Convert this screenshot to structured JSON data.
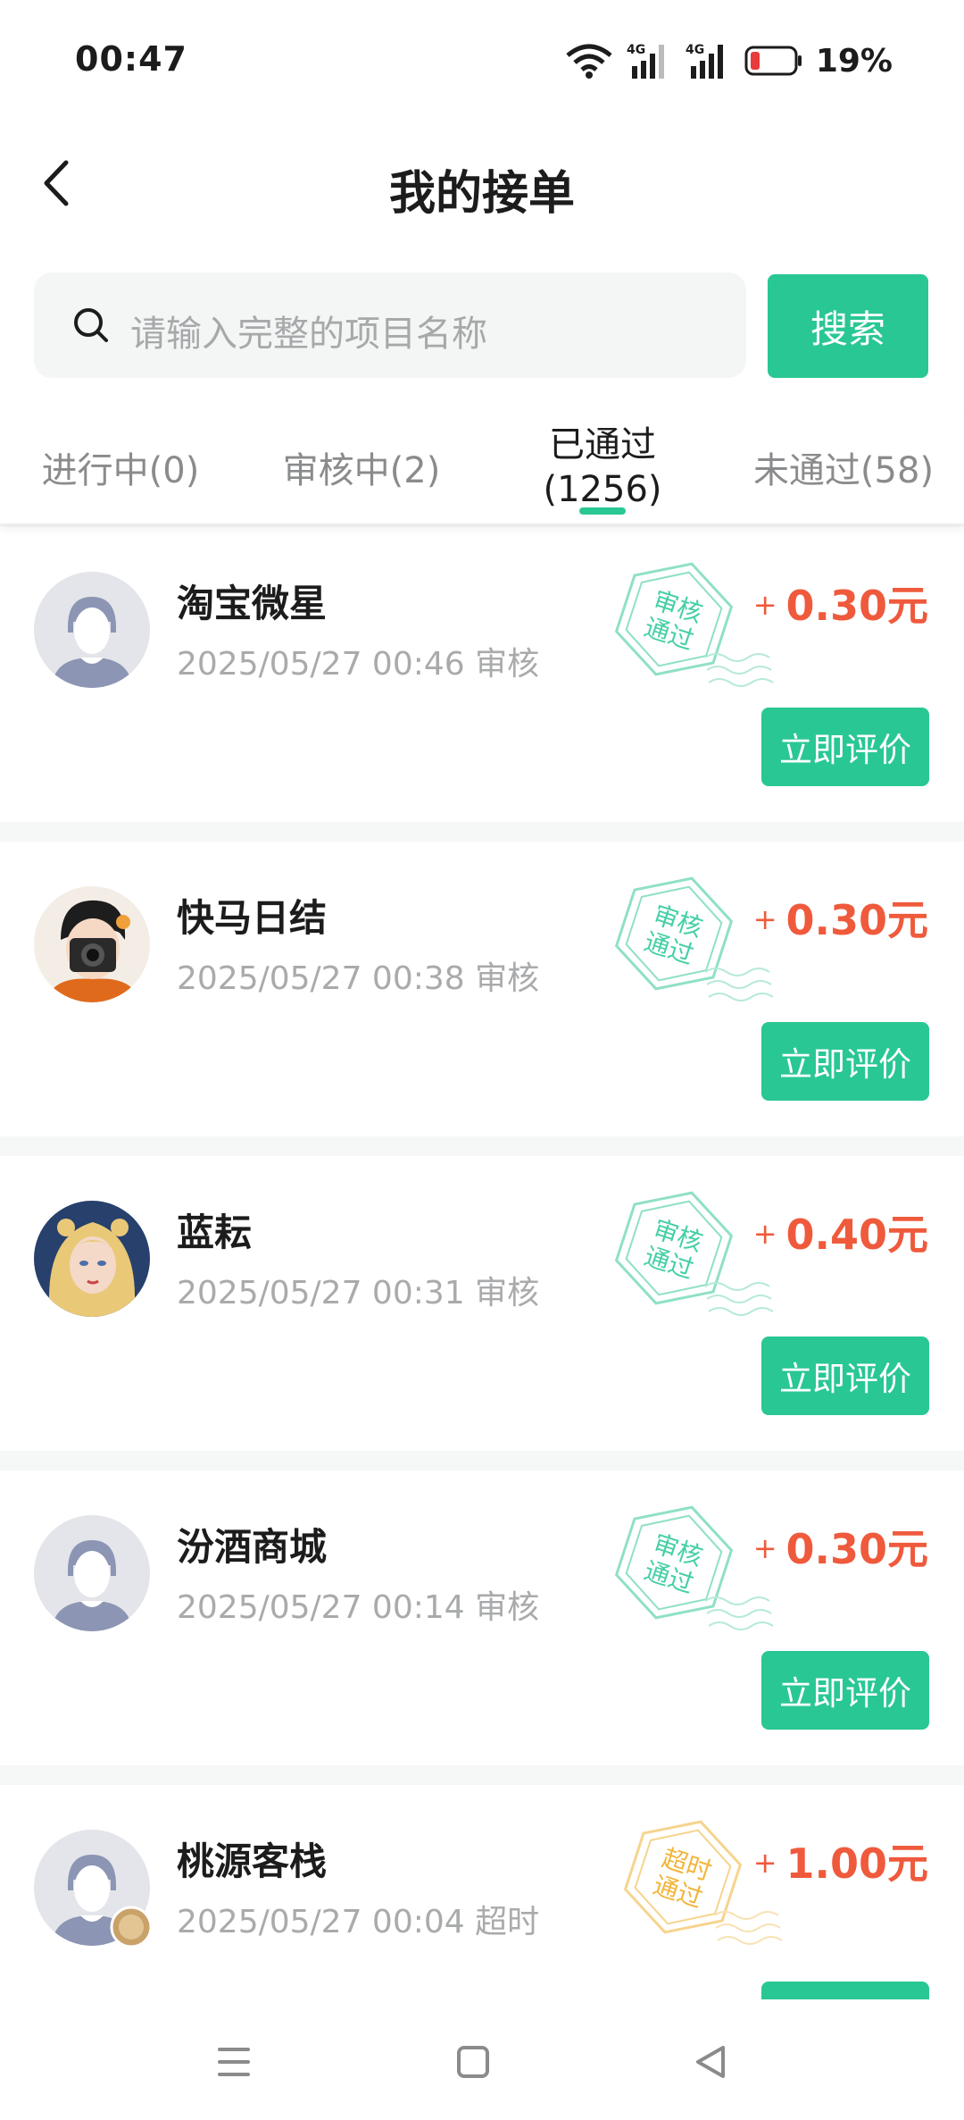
{
  "status_bar": {
    "time": "00:47",
    "battery": "19%"
  },
  "header": {
    "title": "我的接单"
  },
  "search": {
    "placeholder": "请输入完整的项目名称",
    "button": "搜索"
  },
  "tabs": [
    {
      "label": "进行中(0)"
    },
    {
      "label": "审核中(2)"
    },
    {
      "label_line1": "已通过",
      "label_line2": "(1256)"
    },
    {
      "label": "未通过(58)"
    }
  ],
  "orders": [
    {
      "name": "淘宝微星",
      "meta": "2025/05/27 00:46 审核",
      "stamp_l1": "审核",
      "stamp_l2": "通过",
      "plus": "+",
      "amount": "0.30元",
      "button": "立即评价"
    },
    {
      "name": "快马日结",
      "meta": "2025/05/27 00:38 审核",
      "stamp_l1": "审核",
      "stamp_l2": "通过",
      "plus": "+",
      "amount": "0.30元",
      "button": "立即评价"
    },
    {
      "name": "蓝耘",
      "meta": "2025/05/27 00:31 审核",
      "stamp_l1": "审核",
      "stamp_l2": "通过",
      "plus": "+",
      "amount": "0.40元",
      "button": "立即评价"
    },
    {
      "name": "汾酒商城",
      "meta": "2025/05/27 00:14 审核",
      "stamp_l1": "审核",
      "stamp_l2": "通过",
      "plus": "+",
      "amount": "0.30元",
      "button": "立即评价"
    },
    {
      "name": "桃源客栈",
      "meta": "2025/05/27 00:04 超时",
      "stamp_l1": "超时",
      "stamp_l2": "通过",
      "plus": "+",
      "amount": "1.00元",
      "button": ""
    }
  ],
  "colors": {
    "accent": "#29c794",
    "amount": "#ef5a3c",
    "stamp_green": "#45cfa7",
    "stamp_orange": "#f2b53a"
  }
}
